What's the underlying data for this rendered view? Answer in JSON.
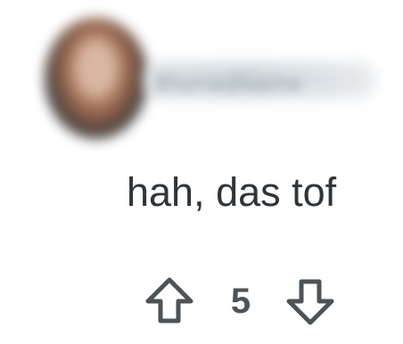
{
  "comment": {
    "author": {
      "username": "BlurredName",
      "avatar_icon": "user-avatar"
    },
    "text": "hah, das tof",
    "votes": {
      "count": "5",
      "upvote_icon": "arrow-up-icon",
      "downvote_icon": "arrow-down-icon"
    }
  },
  "colors": {
    "text": "#2f3538",
    "vote_text": "#4d5357",
    "vote_icon": "#4d5357"
  }
}
